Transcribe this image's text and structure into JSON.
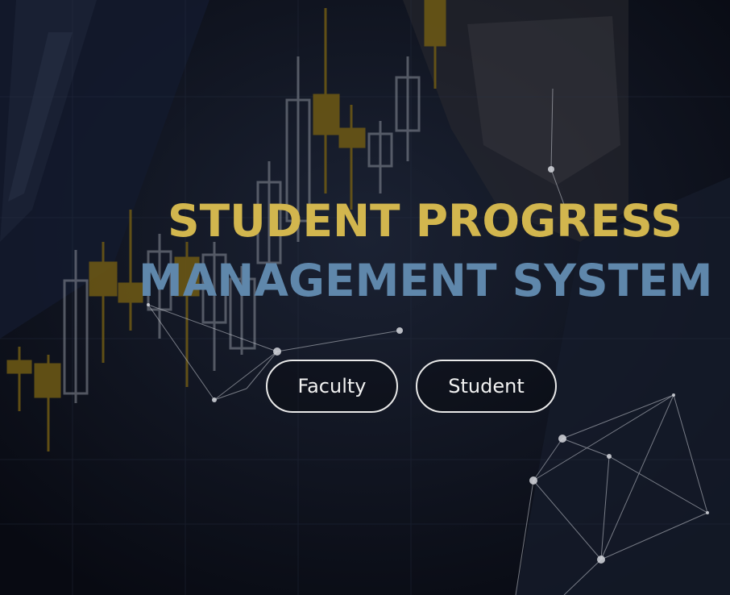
{
  "hero": {
    "title_line_1": "STUDENT PROGRESS",
    "title_line_2": "MANAGEMENT SYSTEM"
  },
  "buttons": {
    "faculty_label": "Faculty",
    "student_label": "Student"
  },
  "colors": {
    "background": "#0c0f18",
    "title_line_1": "#d2b64e",
    "title_line_2": "#5f87ab",
    "button_border": "#e9e9e9",
    "button_text": "#f2f2f2",
    "candle_gold": "#6f5a14",
    "candle_outline": "#8a8f99"
  },
  "icons": {
    "background": "candlestick-network-background"
  }
}
